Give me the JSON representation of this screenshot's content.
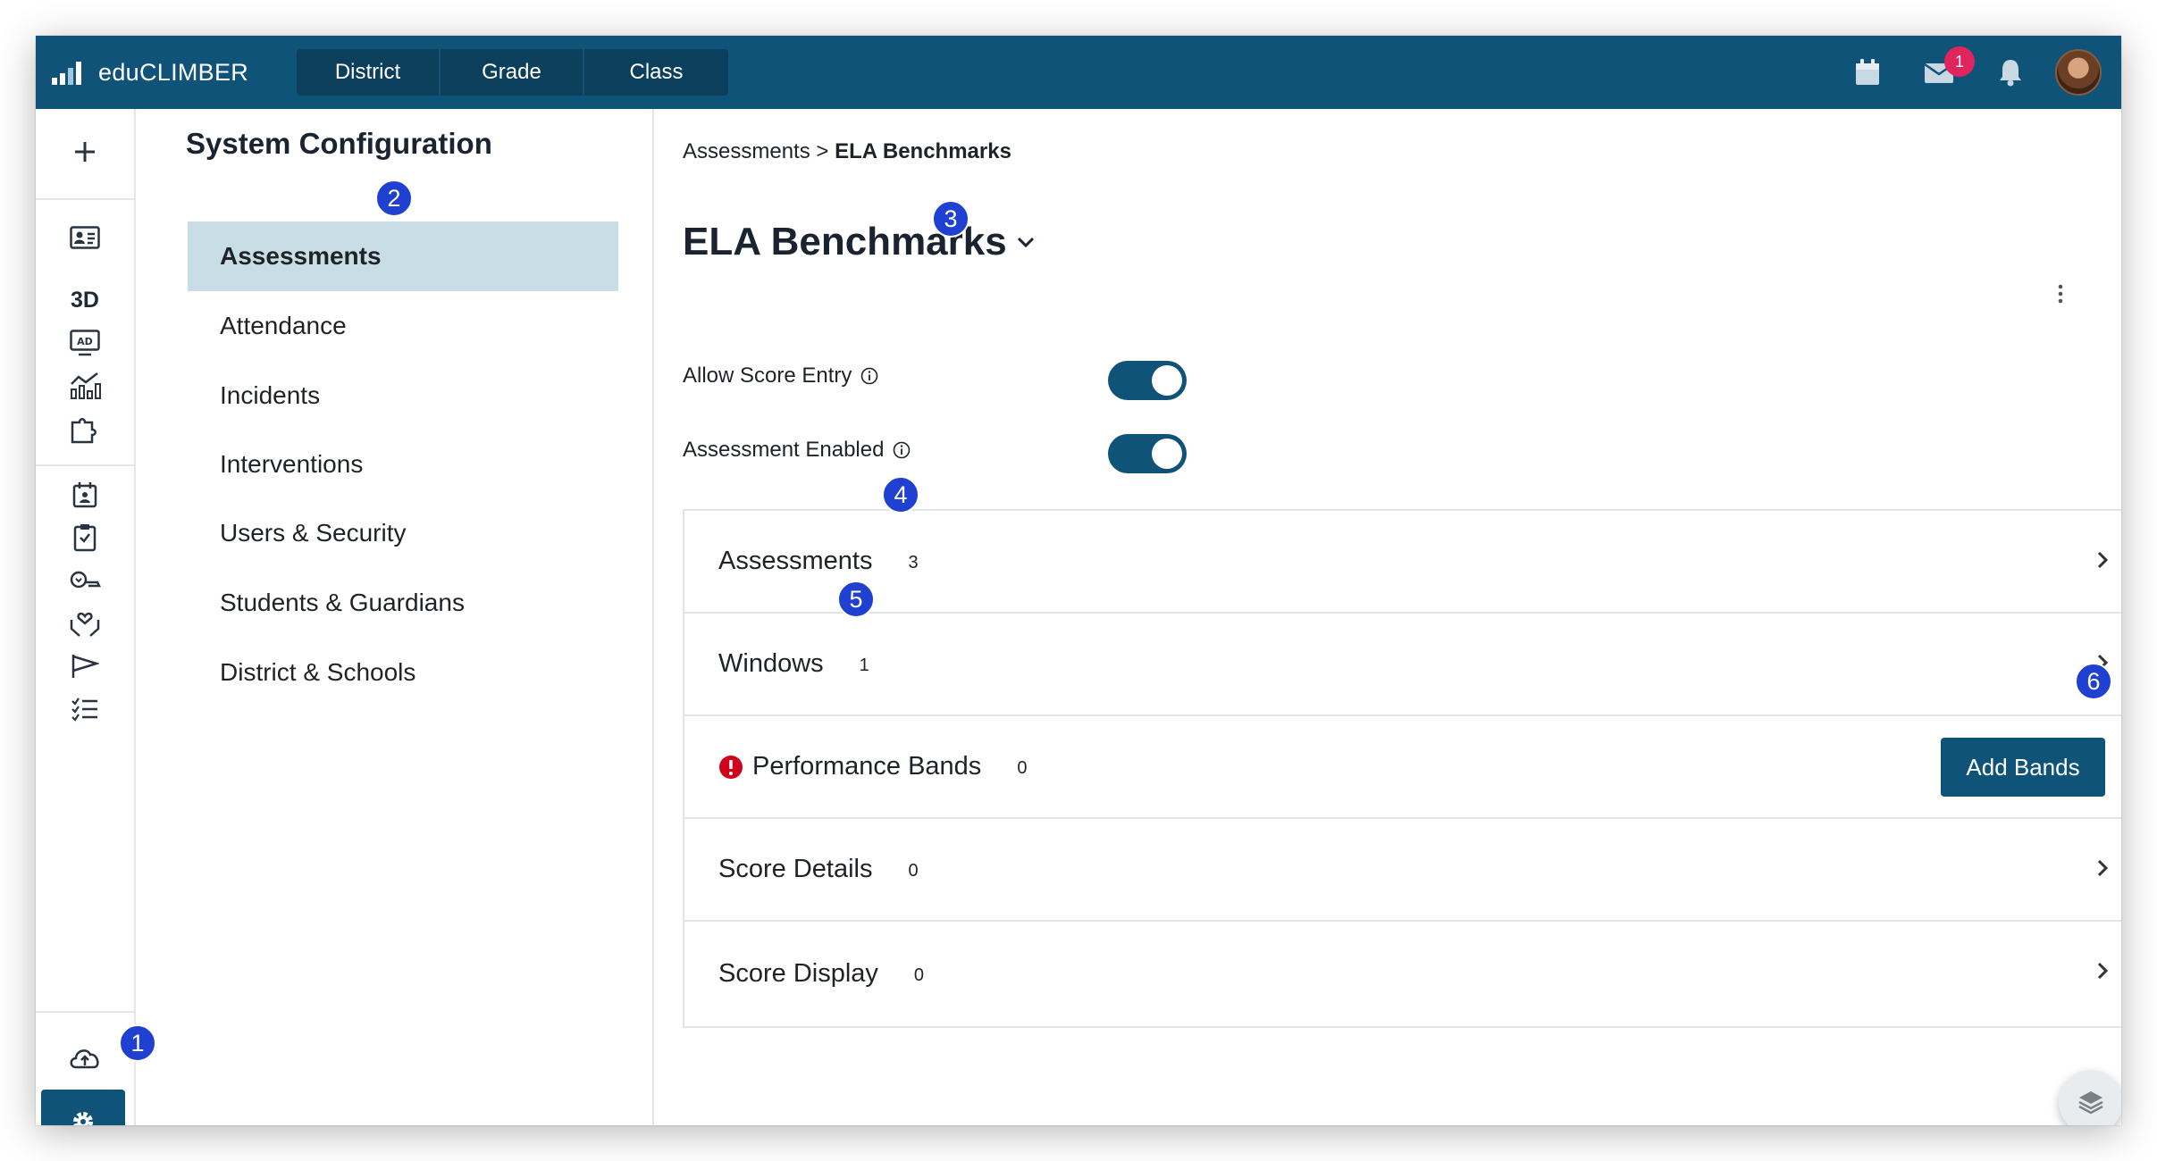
{
  "app": {
    "name": "eduCLIMBER"
  },
  "level_tabs": [
    "District",
    "Grade",
    "Class"
  ],
  "header": {
    "message_badge": "1"
  },
  "config_nav": {
    "title": "System Configuration",
    "items": [
      "Assessments",
      "Attendance",
      "Incidents",
      "Interventions",
      "Users & Security",
      "Students & Guardians",
      "District & Schools"
    ]
  },
  "breadcrumb": {
    "parent": "Assessments",
    "separator": ">",
    "current": "ELA Benchmarks"
  },
  "page": {
    "title": "ELA Benchmarks"
  },
  "toggles": [
    {
      "label": "Allow Score Entry",
      "on": true
    },
    {
      "label": "Assessment Enabled",
      "on": true
    }
  ],
  "sections": [
    {
      "label": "Assessments",
      "count": "3"
    },
    {
      "label": "Windows",
      "count": "1"
    },
    {
      "label": "Performance Bands",
      "count": "0",
      "button": "Add Bands"
    },
    {
      "label": "Score Details",
      "count": "0"
    },
    {
      "label": "Score Display",
      "count": "0"
    }
  ],
  "markers": [
    "1",
    "2",
    "3",
    "4",
    "5",
    "6"
  ],
  "colors": {
    "primary": "#0f5478",
    "active_nav": "#c8dde6",
    "marker": "#1f40d0",
    "badge": "#e0245e",
    "warning": "#d0021b"
  }
}
